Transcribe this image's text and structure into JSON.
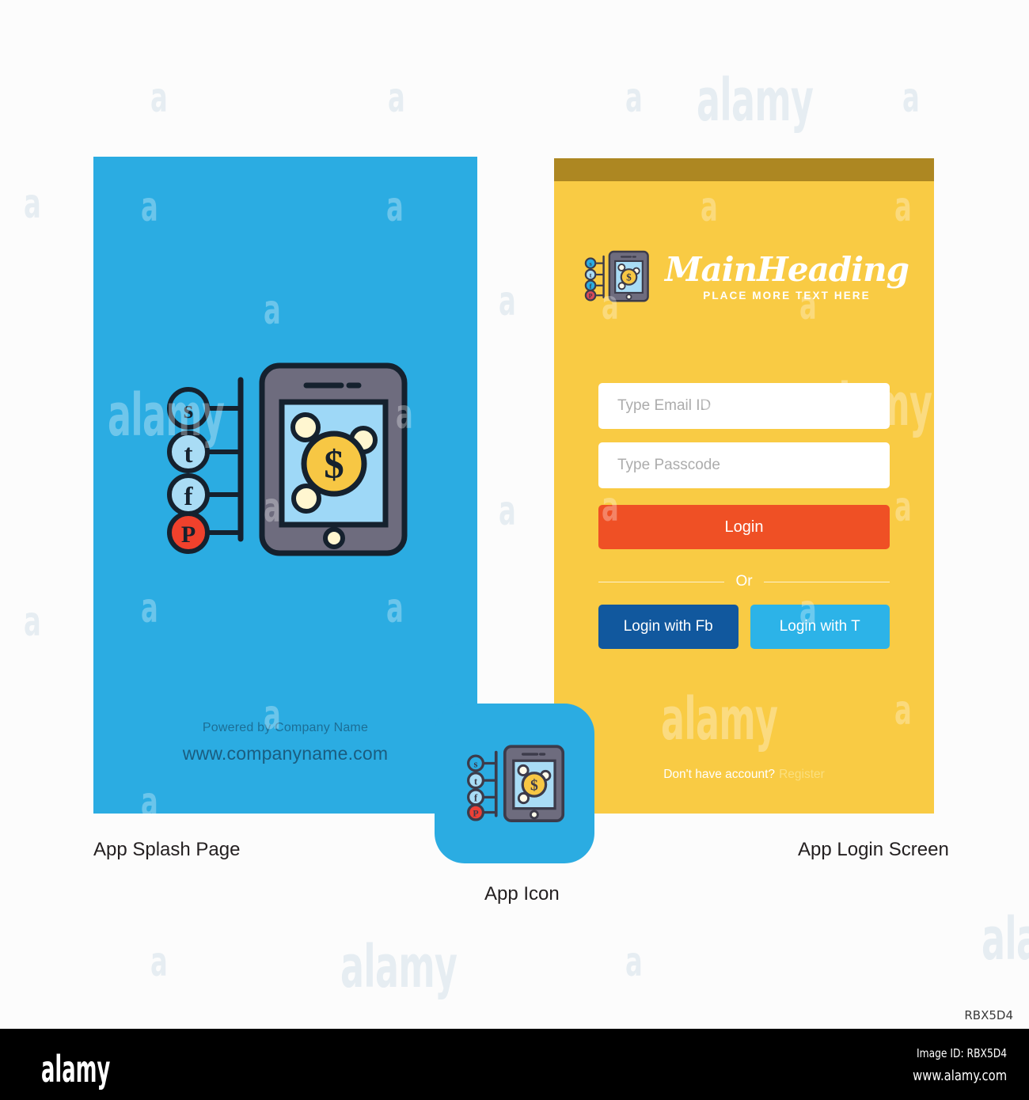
{
  "meta": {
    "corner_code": "RBX5D4"
  },
  "splash": {
    "bg_color": "#2BACE2",
    "powered_by": "Powered by Company Name",
    "website": "www.companyname.com",
    "caption": "App Splash Page"
  },
  "app_icon": {
    "bg_color": "#2BACE2",
    "caption": "App Icon"
  },
  "login": {
    "bg_color": "#F9CB44",
    "statusbar_color": "#AD8722",
    "heading": "MainHeading",
    "subheading": "PLACE MORE TEXT HERE",
    "email_placeholder": "Type Email ID",
    "email_value": "",
    "passcode_placeholder": "Type Passcode",
    "passcode_value": "",
    "login_label": "Login",
    "login_color": "#EF5025",
    "or_label": "Or",
    "facebook_label": "Login with Fb",
    "facebook_color": "#11589E",
    "twitter_label": "Login with T",
    "twitter_color": "#2CB3E8",
    "register_question": "Don't have account?",
    "register_link": "Register",
    "caption": "App Login Screen"
  },
  "icon_art": {
    "badges": [
      "s",
      "t",
      "f",
      "P"
    ],
    "coin_symbol": "$"
  },
  "watermarks": {
    "brand": "alamy",
    "letter": "a"
  },
  "footer": {
    "logo": "alamy",
    "image_id": "Image ID: RBX5D4",
    "url": "www.alamy.com"
  }
}
